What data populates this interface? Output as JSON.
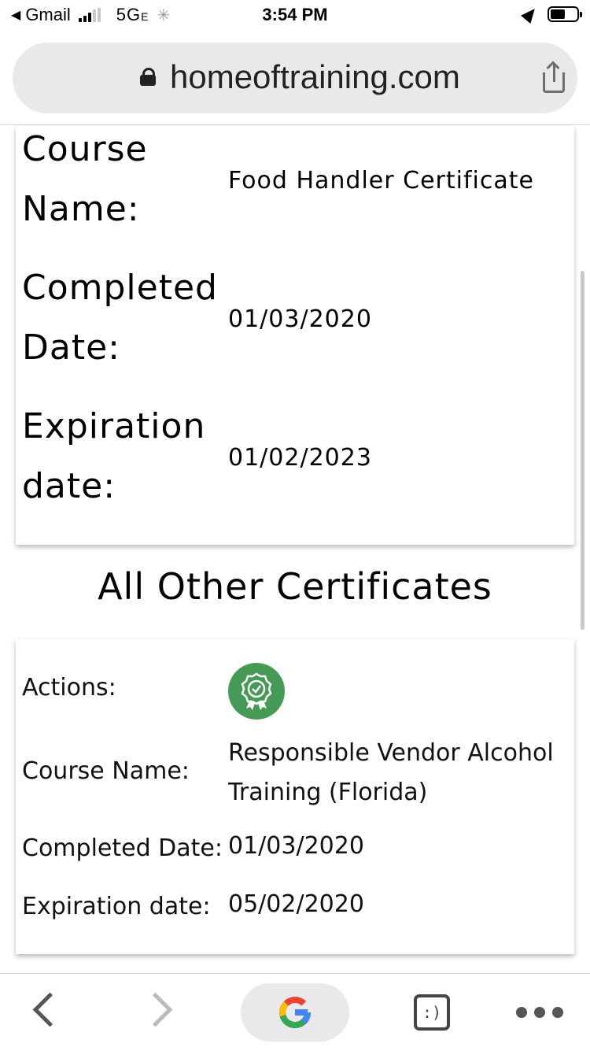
{
  "status_bar": {
    "back_app": "Gmail",
    "network": "5G",
    "network_suffix": "E",
    "time": "3:54 PM"
  },
  "browser": {
    "url": "homeoftraining.com"
  },
  "certificate": {
    "course_name_label_1": "Course",
    "course_name_label_2": "Name:",
    "course_name": "Food Handler Certificate",
    "completed_label_1": "Completed",
    "completed_label_2": "Date:",
    "completed_date": "01/03/2020",
    "expiration_label_1": "Expiration",
    "expiration_label_2": "date:",
    "expiration_date": "01/02/2023"
  },
  "other_heading": "All Other Certificates",
  "other_certificate": {
    "actions_label": "Actions:",
    "action_icon": "certificate-award-icon",
    "course_name_label": "Course Name:",
    "course_name_line1": "Responsible Vendor Alcohol",
    "course_name_line2": "Training (Florida)",
    "completed_label": "Completed Date:",
    "completed_date": "01/03/2020",
    "expiration_label": "Expiration date:",
    "expiration_date": "05/02/2020"
  },
  "toolbar": {
    "tabs_label": ":)"
  },
  "colors": {
    "action_green": "#459a55",
    "url_bar_bg": "#e9e9ec"
  }
}
